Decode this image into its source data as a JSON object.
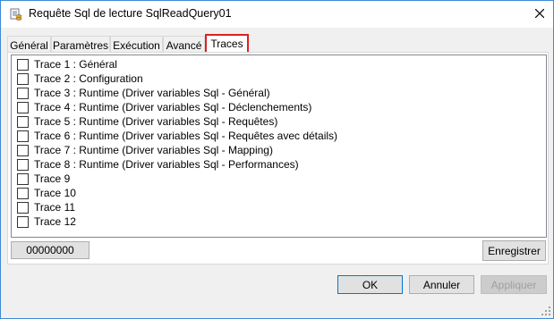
{
  "window": {
    "title": "Requête Sql de lecture SqlReadQuery01",
    "icon": "query-app-icon",
    "close_icon": "close-icon"
  },
  "tabs": [
    {
      "label": "Général",
      "active": false
    },
    {
      "label": "Paramètres",
      "active": false
    },
    {
      "label": "Exécution",
      "active": false
    },
    {
      "label": "Avancé",
      "active": false
    },
    {
      "label": "Traces",
      "active": true
    }
  ],
  "traces": [
    {
      "label": "Trace 1 : Général",
      "checked": false
    },
    {
      "label": "Trace 2 : Configuration",
      "checked": false
    },
    {
      "label": "Trace 3 : Runtime (Driver variables Sql - Général)",
      "checked": false
    },
    {
      "label": "Trace 4 : Runtime (Driver variables Sql - Déclenchements)",
      "checked": false
    },
    {
      "label": "Trace 5 : Runtime (Driver variables Sql - Requêtes)",
      "checked": false
    },
    {
      "label": "Trace 6 : Runtime (Driver variables Sql - Requêtes avec détails)",
      "checked": false
    },
    {
      "label": "Trace 7 : Runtime (Driver variables Sql - Mapping)",
      "checked": false
    },
    {
      "label": "Trace 8 : Runtime (Driver variables Sql - Performances)",
      "checked": false
    },
    {
      "label": "Trace 9",
      "checked": false
    },
    {
      "label": "Trace 10",
      "checked": false
    },
    {
      "label": "Trace 11",
      "checked": false
    },
    {
      "label": "Trace 12",
      "checked": false
    }
  ],
  "panel": {
    "mask_value": "00000000",
    "save_label": "Enregistrer"
  },
  "footer": {
    "ok_label": "OK",
    "cancel_label": "Annuler",
    "apply_label": "Appliquer"
  },
  "colors": {
    "active_tab_border": "#e02020",
    "window_border": "#3c8ad6",
    "default_button_border": "#0078d7"
  }
}
